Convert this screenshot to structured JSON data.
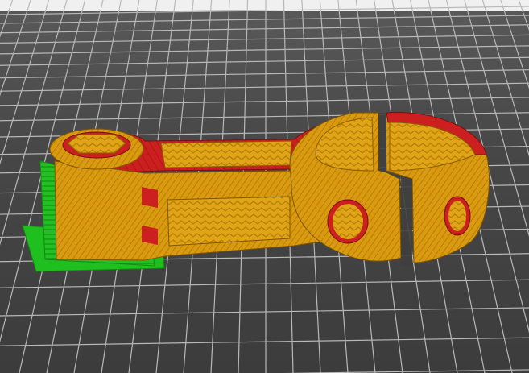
{
  "app": {
    "view": "3d-print-preview",
    "colors": {
      "background": "#444444",
      "grid_line": "#b8b8b8",
      "top_strip": "#f0f0f0",
      "infill_orange": "#d99a10",
      "solid_red": "#cc1f1f",
      "support_green": "#1fbf1f"
    },
    "legend": []
  }
}
